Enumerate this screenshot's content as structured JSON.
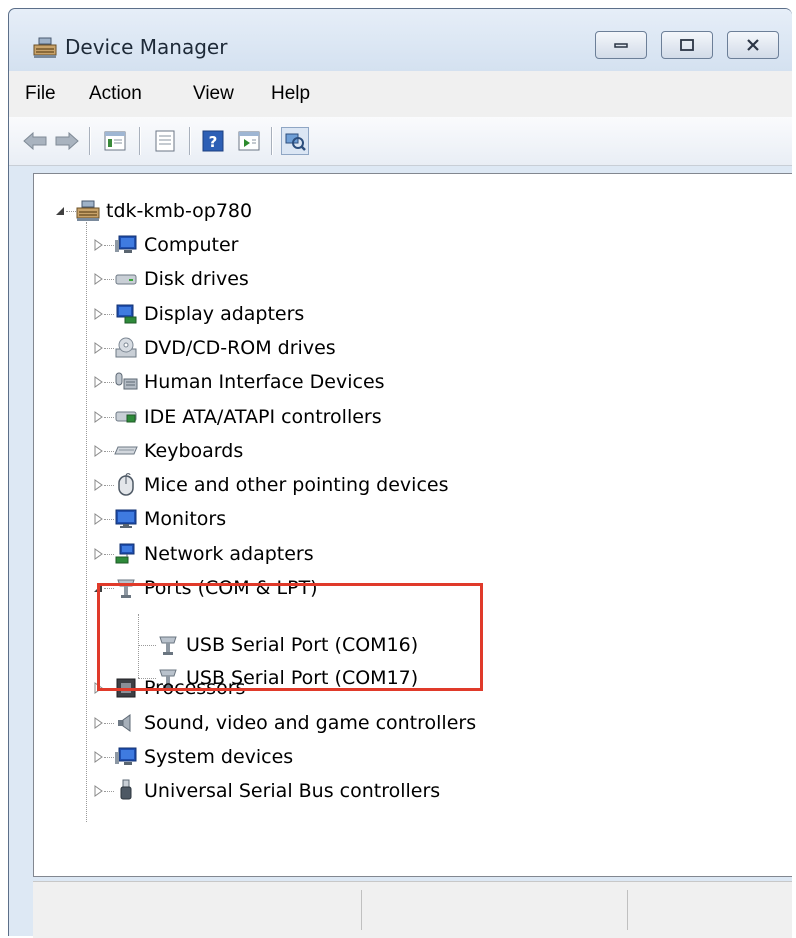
{
  "window": {
    "title": "Device Manager"
  },
  "menu": [
    "File",
    "Action",
    "View",
    "Help"
  ],
  "toolbar": {
    "buttons": [
      "back-arrow-icon",
      "forward-arrow-icon",
      "console-tree-icon",
      "properties-icon",
      "help-icon",
      "run-icon",
      "scan-hardware-icon"
    ]
  },
  "tree": {
    "root": "tdk-kmb-op780",
    "categories": [
      {
        "label": "Computer",
        "icon": "computer-icon"
      },
      {
        "label": "Disk drives",
        "icon": "disk-drive-icon"
      },
      {
        "label": "Display adapters",
        "icon": "display-adapter-icon"
      },
      {
        "label": "DVD/CD-ROM drives",
        "icon": "dvd-drive-icon"
      },
      {
        "label": "Human Interface Devices",
        "icon": "hid-icon"
      },
      {
        "label": "IDE ATA/ATAPI controllers",
        "icon": "ide-controller-icon"
      },
      {
        "label": "Keyboards",
        "icon": "keyboard-icon"
      },
      {
        "label": "Mice and other pointing devices",
        "icon": "mouse-icon"
      },
      {
        "label": "Monitors",
        "icon": "monitor-icon"
      },
      {
        "label": "Network adapters",
        "icon": "network-adapter-icon"
      },
      {
        "label": "Ports (COM & LPT)",
        "icon": "port-icon",
        "expanded": true,
        "children": [
          "USB Serial Port (COM16)",
          "USB Serial Port (COM17)"
        ]
      },
      {
        "label": "Processors",
        "icon": "processor-icon"
      },
      {
        "label": "Sound, video and game controllers",
        "icon": "speaker-icon"
      },
      {
        "label": "System devices",
        "icon": "system-device-icon"
      },
      {
        "label": "Universal Serial Bus controllers",
        "icon": "usb-icon"
      }
    ]
  },
  "colors": {
    "highlight": "#e03a2a"
  }
}
